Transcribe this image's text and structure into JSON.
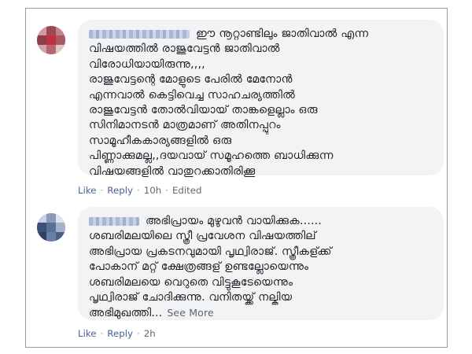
{
  "comments": [
    {
      "lines": [
        "ഈ നൂറ്റാണ്ടിലും ജാതിവാൽ എന്ന",
        "വിഷയത്തിൽ രാജുവേട്ടൻ ജാതിവാൽ",
        "വിരോധിയായിരുന്നു,,,,",
        "രാജുവേട്ടന്റെ മോളുടെ പേരിൽ മേനോൻ",
        "എന്നവാൽ കെട്ടിവെച്ച സാഹചര്യത്തിൽ",
        "രാജുവേട്ടൻ തോൽവിയായ് താങ്കളെല്ലാം ഒരു",
        "സിനിമാനടൻ മാത്രമാണ് അതിനപ്പുറം",
        "സാമൂഹീകകാര്യങ്ങളിൽ ഒരു",
        "പിണ്ണാക്കുമല്ല,,ദയവായ് സമൂഹത്തെ ബാധിക്കുന്ന",
        "വിഷയങ്ങളിൽ വാതുറക്കാതിരിക്കൂ"
      ],
      "see_more": "",
      "actions": {
        "like": "Like",
        "reply": "Reply",
        "time": "10h",
        "edited": "Edited"
      }
    },
    {
      "lines": [
        "അഭിപ്രായം മുഴുവൻ വായിക്കുക......",
        "ശബരിമലയിലെ സ്ത്രീ പ്രവേശന വിഷയത്തില്",
        "അഭിപ്രായ പ്രകടനവുമായി പൃഥ്വിരാജ്. സ്ത്രീകള്ക്ക്",
        "പോകാന് മറ്റ് ക്ഷേത്രങ്ങള് ഉണ്ടല്ലോയെന്നും",
        "ശബരിമലയെ വെറുതെ വിട്ടുകൂടേയെന്നും",
        "പൃഥ്വിരാജ് ചോദിക്കുന്നു. വനിതയ്ക്ക് നല്കിയ",
        "അഭിമുഖത്തി..."
      ],
      "see_more": "See More",
      "actions": {
        "like": "Like",
        "reply": "Reply",
        "time": "2h",
        "edited": ""
      }
    }
  ],
  "colors": {
    "link": "#4b6099",
    "meta": "#606770",
    "bubble": "#f2f3f5",
    "text": "#1c1e21"
  },
  "icons": [
    "avatar-1-pixelated",
    "avatar-2-pixelated"
  ]
}
